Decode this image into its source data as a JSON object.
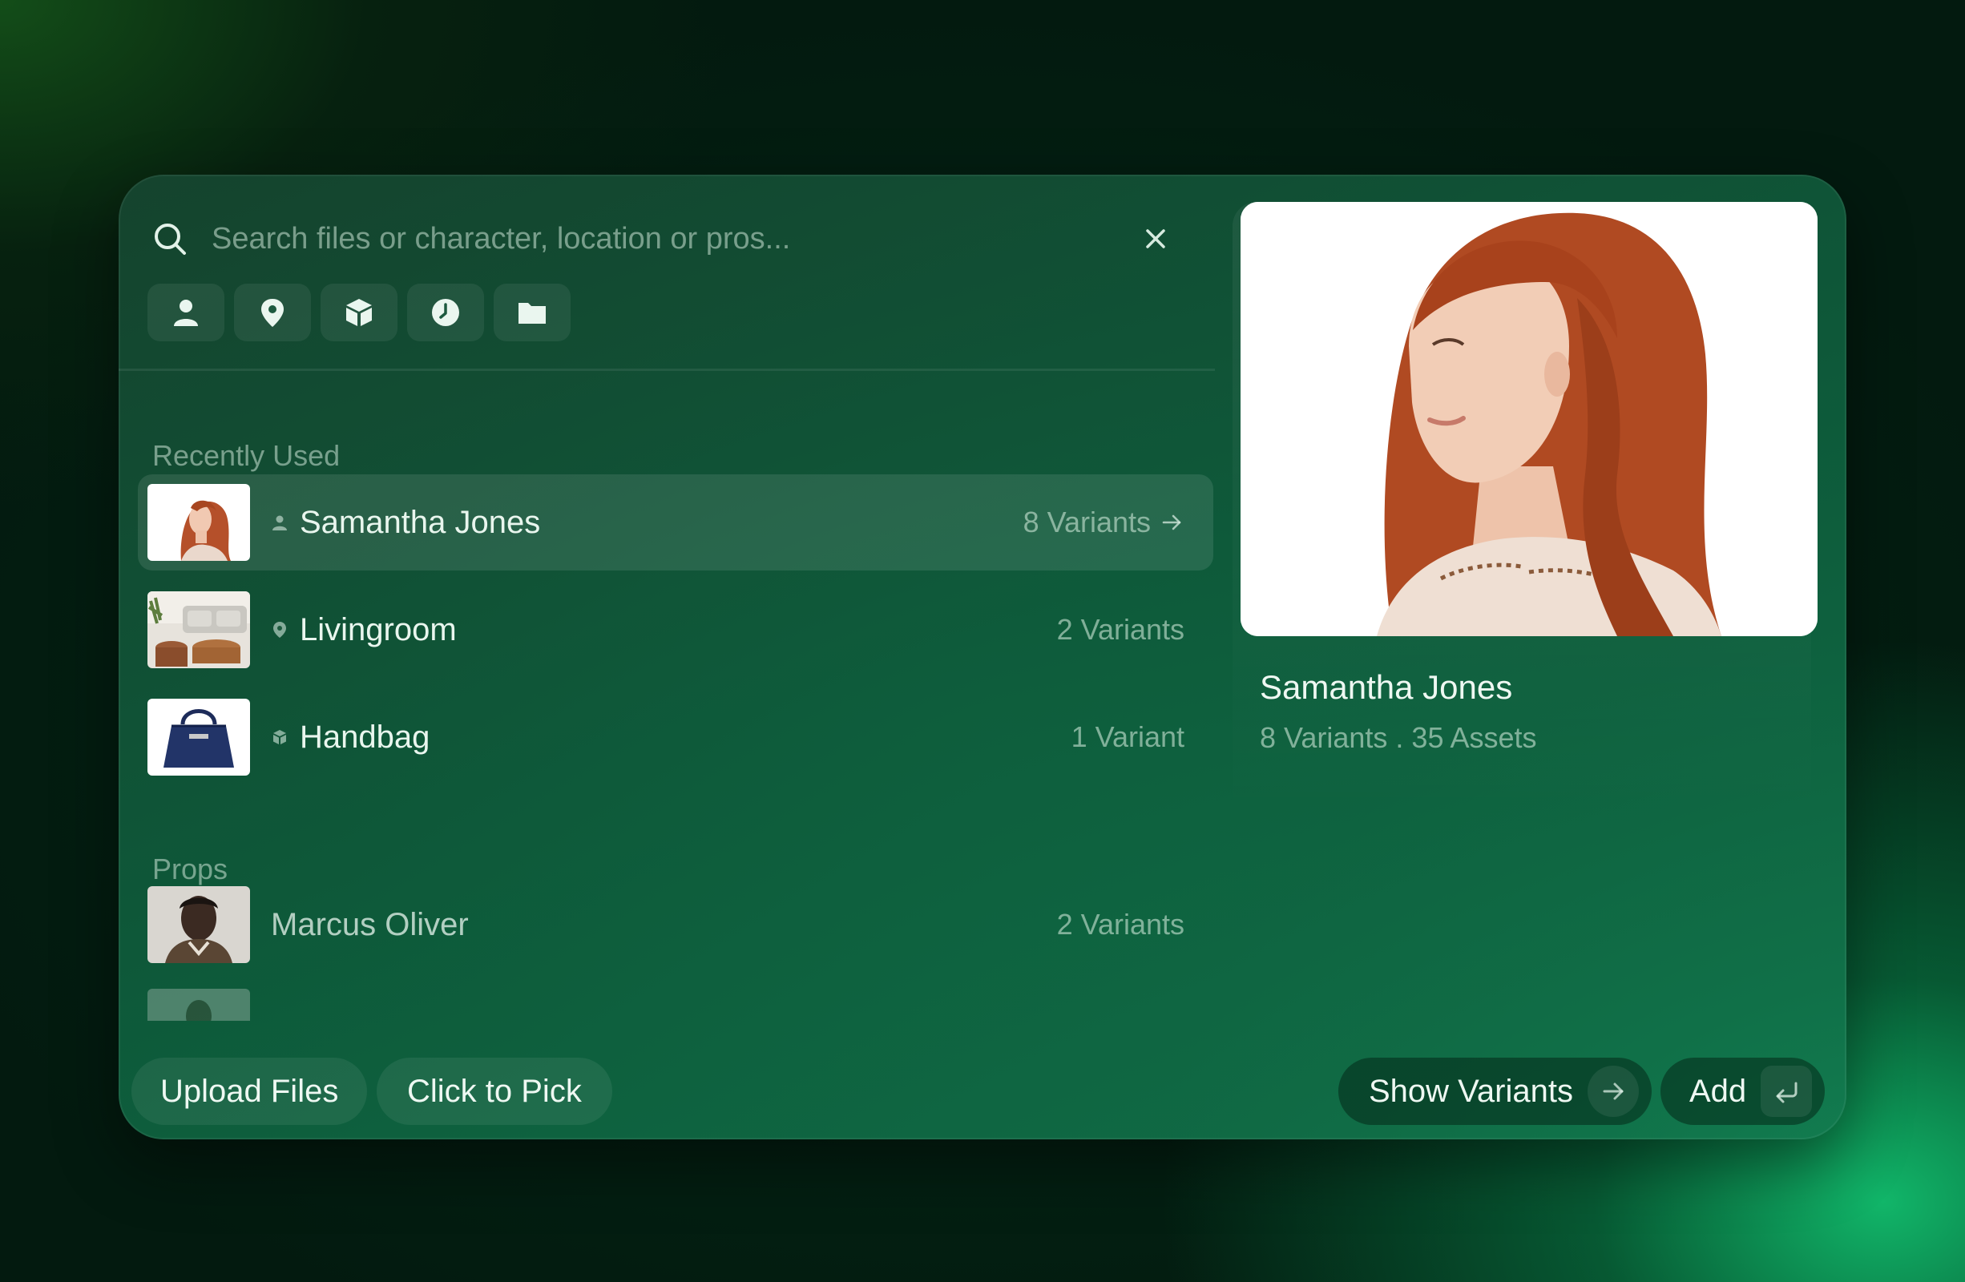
{
  "search": {
    "placeholder": "Search files or character, location or pros...",
    "value": ""
  },
  "filters": [
    {
      "icon": "person-icon"
    },
    {
      "icon": "location-pin-icon"
    },
    {
      "icon": "cube-icon"
    },
    {
      "icon": "clock-icon"
    },
    {
      "icon": "folder-icon"
    }
  ],
  "sections": {
    "recent_title": "Recently Used",
    "props_title": "Props"
  },
  "recent": [
    {
      "name": "Samantha Jones",
      "count": "8 Variants",
      "type_icon": "person-icon",
      "active": true
    },
    {
      "name": "Livingroom",
      "count": "2 Variants",
      "type_icon": "location-pin-icon",
      "active": false
    },
    {
      "name": "Handbag",
      "count": "1 Variant",
      "type_icon": "cube-icon",
      "active": false
    }
  ],
  "props": [
    {
      "name": "Marcus Oliver",
      "count": "2 Variants"
    }
  ],
  "preview": {
    "title": "Samantha Jones",
    "meta": "8 Variants . 35 Assets"
  },
  "footer": {
    "upload_label": "Upload Files",
    "pick_label": "Click to Pick",
    "show_variants_label": "Show Variants",
    "add_label": "Add"
  }
}
